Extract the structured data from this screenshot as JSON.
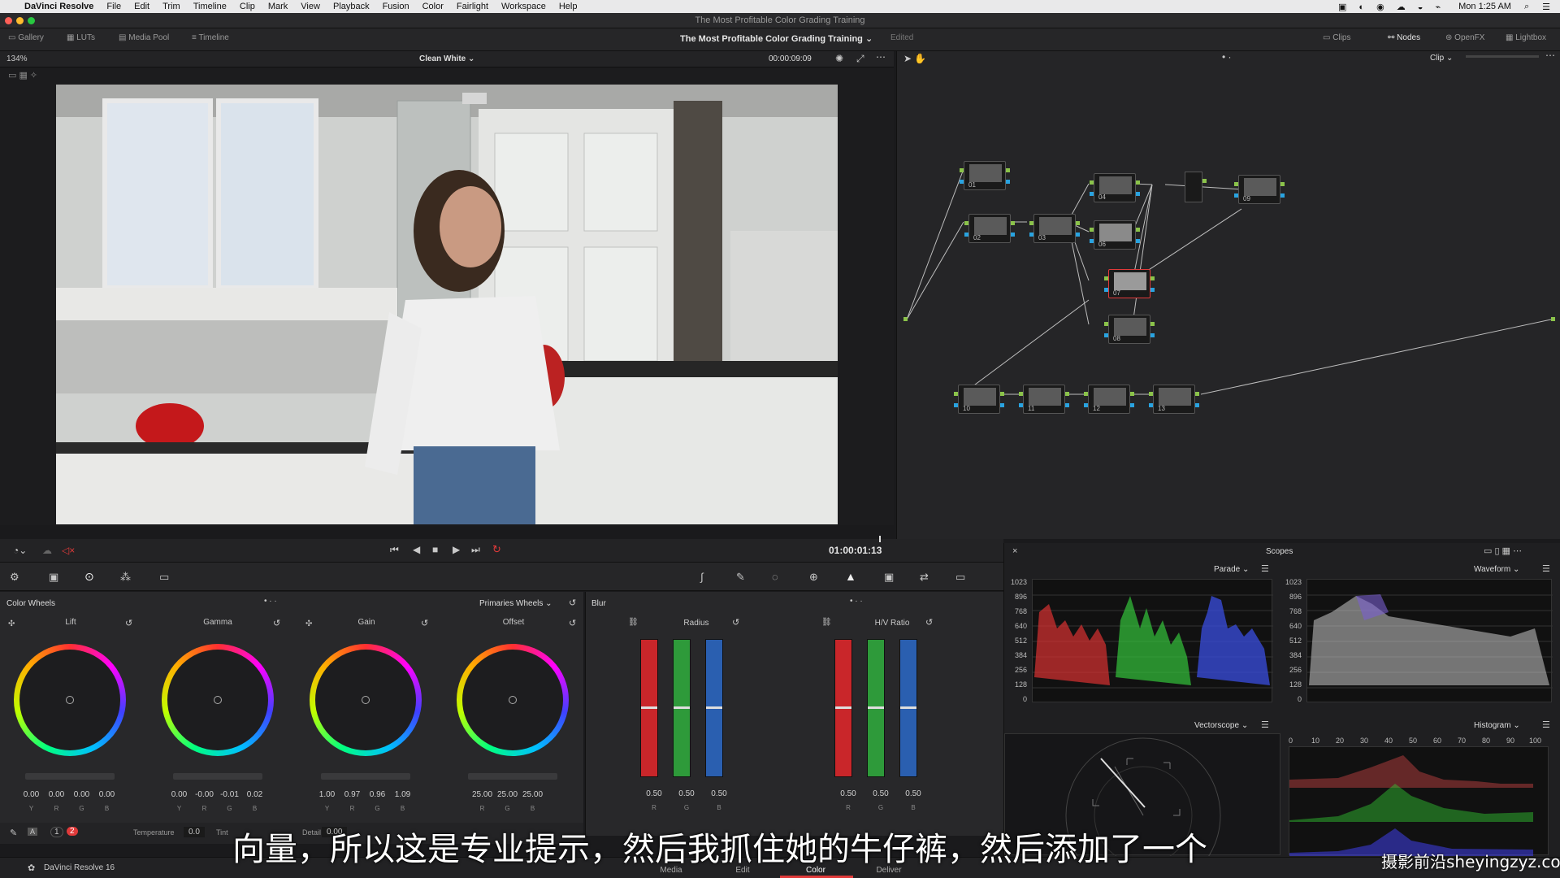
{
  "menubar": {
    "app": "DaVinci Resolve",
    "items": [
      "File",
      "Edit",
      "Trim",
      "Timeline",
      "Clip",
      "Mark",
      "View",
      "Playback",
      "Fusion",
      "Color",
      "Fairlight",
      "Workspace",
      "Help"
    ],
    "clock": "Mon 1:25 AM"
  },
  "window": {
    "title": "The Most Profitable Color Grading Training"
  },
  "toolbar": {
    "gallery": "Gallery",
    "luts": "LUTs",
    "media_pool": "Media Pool",
    "timeline": "Timeline",
    "project": "The Most Profitable Color Grading Training",
    "status": "Edited",
    "clips": "Clips",
    "nodes": "Nodes",
    "openfx": "OpenFX",
    "lightbox": "Lightbox"
  },
  "viewer": {
    "zoom": "134%",
    "clip_name": "Clean White",
    "clip_time": "00:00:09:09",
    "timecode": "01:00:01:13"
  },
  "nodes": {
    "mode": "Clip",
    "list": [
      {
        "id": "n01",
        "label": "01"
      },
      {
        "id": "n02",
        "label": "02"
      },
      {
        "id": "n03",
        "label": "03"
      },
      {
        "id": "n04",
        "label": "04"
      },
      {
        "id": "n06",
        "label": "06"
      },
      {
        "id": "n07",
        "label": "07"
      },
      {
        "id": "n08",
        "label": "08"
      },
      {
        "id": "n09",
        "label": "09"
      },
      {
        "id": "n10",
        "label": "10"
      },
      {
        "id": "n11",
        "label": "11"
      },
      {
        "id": "n12",
        "label": "12"
      },
      {
        "id": "n13",
        "label": "13"
      }
    ]
  },
  "color_wheels": {
    "title": "Color Wheels",
    "mode": "Primaries Wheels",
    "wheels": [
      {
        "name": "Lift",
        "values": [
          "0.00",
          "0.00",
          "0.00",
          "0.00"
        ]
      },
      {
        "name": "Gamma",
        "values": [
          "0.00",
          "-0.00",
          "-0.01",
          "0.02"
        ]
      },
      {
        "name": "Gain",
        "values": [
          "1.00",
          "0.97",
          "0.96",
          "1.09"
        ]
      },
      {
        "name": "Offset",
        "values": [
          "25.00",
          "25.00",
          "25.00"
        ]
      }
    ],
    "channels4": [
      "Y",
      "R",
      "G",
      "B"
    ],
    "channels3": [
      "R",
      "G",
      "B"
    ]
  },
  "adjust": {
    "temperature_label": "Temperature",
    "temperature": "0.0",
    "tint_label": "Tint",
    "detail_label": "Detail",
    "detail": "0.00",
    "page1": "1",
    "page2": "2"
  },
  "blur": {
    "title": "Blur",
    "radius": {
      "label": "Radius",
      "values": [
        "0.50",
        "0.50",
        "0.50"
      ]
    },
    "hv": {
      "label": "H/V Ratio",
      "values": [
        "0.50",
        "0.50",
        "0.50"
      ]
    },
    "channels": [
      "R",
      "G",
      "B"
    ]
  },
  "scopes": {
    "title": "Scopes",
    "parade": "Parade",
    "waveform": "Waveform",
    "vectorscope": "Vectorscope",
    "histogram": "Histogram",
    "yaxis": [
      "1023",
      "896",
      "768",
      "640",
      "512",
      "384",
      "256",
      "128",
      "0"
    ],
    "hist_x": [
      "0",
      "10",
      "20",
      "30",
      "40",
      "50",
      "60",
      "70",
      "80",
      "90",
      "100"
    ]
  },
  "pages": {
    "app_version": "DaVinci Resolve 16",
    "media": "Media",
    "edit": "Edit",
    "color": "Color",
    "deliver": "Deliver"
  },
  "overlay": {
    "subtitle": "向量，所以这是专业提示，然后我抓住她的牛仔裤，然后添加了一个",
    "watermark": "摄影前沿sheyingzyz.com"
  },
  "colors": {
    "accent_red": "#e03a3a",
    "node_green": "#8bc34a",
    "node_blue": "#29a3e0"
  }
}
